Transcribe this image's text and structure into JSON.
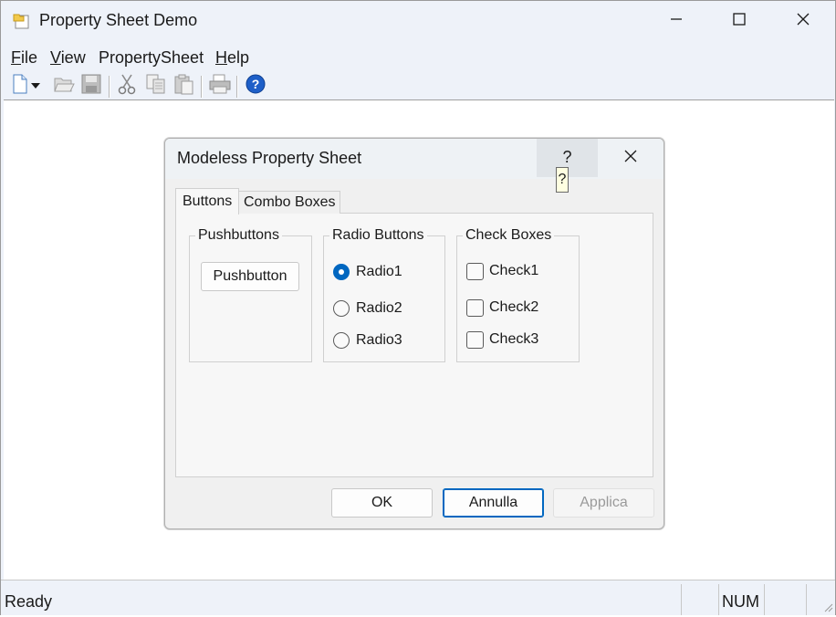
{
  "window": {
    "title": "Property Sheet Demo",
    "app_icon": "folder-document-icon",
    "controls": [
      "minimize-icon",
      "maximize-icon",
      "close-icon"
    ]
  },
  "menu": {
    "items": [
      {
        "label": "File",
        "mnemonic": "F"
      },
      {
        "label": "View",
        "mnemonic": "V"
      },
      {
        "label": "PropertySheet",
        "mnemonic": ""
      },
      {
        "label": "Help",
        "mnemonic": "H"
      }
    ]
  },
  "toolbar": {
    "icons": [
      "new-file-icon",
      "dropdown-arrow-icon",
      "open-icon",
      "save-icon",
      "cut-icon",
      "copy-icon",
      "paste-icon",
      "print-icon",
      "help-icon"
    ]
  },
  "dialog": {
    "title": "Modeless Property Sheet",
    "help_label": "?",
    "tooltip": "?",
    "tabs": [
      {
        "label": "Buttons",
        "active": true
      },
      {
        "label": "Combo Boxes",
        "active": false
      }
    ],
    "groups": {
      "pushbuttons": {
        "label": "Pushbuttons",
        "button": "Pushbutton"
      },
      "radios": {
        "label": "Radio Buttons",
        "items": [
          {
            "label": "Radio1",
            "checked": true
          },
          {
            "label": "Radio2",
            "checked": false
          },
          {
            "label": "Radio3",
            "checked": false
          }
        ]
      },
      "checks": {
        "label": "Check Boxes",
        "items": [
          {
            "label": "Check1",
            "checked": false
          },
          {
            "label": "Check2",
            "checked": false
          },
          {
            "label": "Check3",
            "checked": false
          }
        ]
      }
    },
    "buttons": {
      "ok": "OK",
      "cancel": "Annulla",
      "apply": "Applica",
      "apply_enabled": false
    }
  },
  "status": {
    "text": "Ready",
    "num": "NUM"
  },
  "colors": {
    "accent": "#0067c0",
    "chrome": "#eef2f9",
    "dialog_bg": "#f0f0f0"
  }
}
